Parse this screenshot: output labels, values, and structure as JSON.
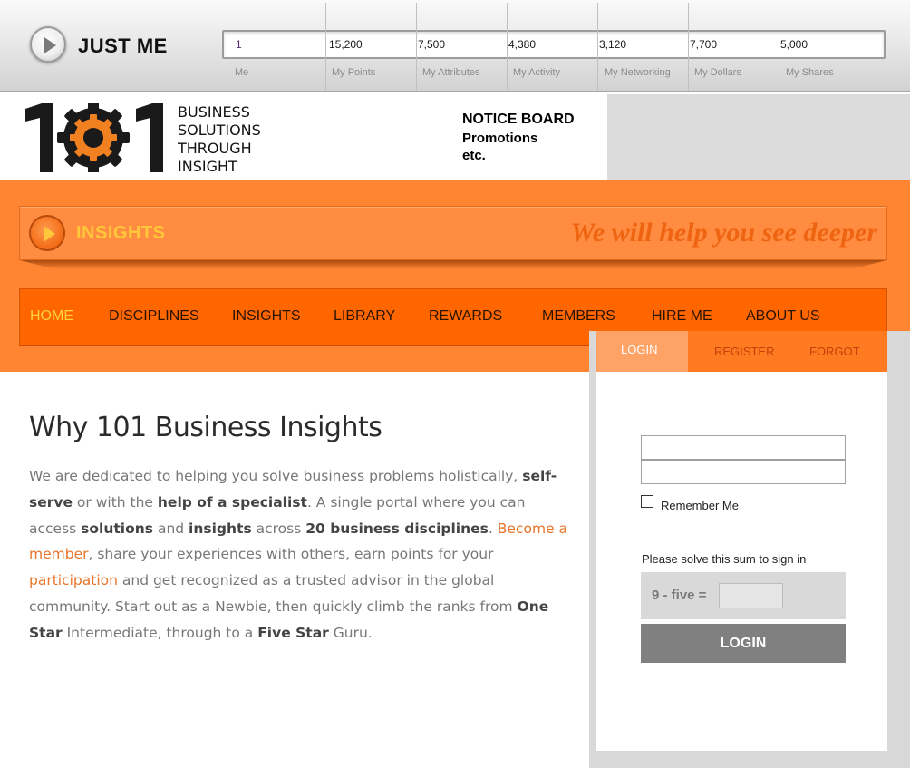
{
  "header": {
    "title": "JUST ME",
    "stats": [
      {
        "value": "1",
        "label": "Me"
      },
      {
        "value": "15,200",
        "label": "My Points"
      },
      {
        "value": "7,500",
        "label": "My Attributes"
      },
      {
        "value": "4,380",
        "label": "My Activity"
      },
      {
        "value": "3,120",
        "label": "My Networking"
      },
      {
        "value": "7,700",
        "label": "My Dollars"
      },
      {
        "value": "5,000",
        "label": "My Shares"
      }
    ]
  },
  "branding": {
    "tagline": [
      "BUSINESS",
      "SOLUTIONS",
      "THROUGH",
      "INSIGHT"
    ],
    "logo_colors": {
      "digits": "#1a1a1a",
      "gear": "#f08020"
    }
  },
  "notice_board": {
    "title": "NOTICE BOARD",
    "lines": [
      "Promotions",
      "etc."
    ]
  },
  "insights_banner": {
    "title": "INSIGHTS",
    "slogan": "We will help you see deeper"
  },
  "nav": {
    "items": [
      {
        "label": "HOME",
        "active": true
      },
      {
        "label": "DISCIPLINES"
      },
      {
        "label": "INSIGHTS"
      },
      {
        "label": "LIBRARY"
      },
      {
        "label": "REWARDS"
      },
      {
        "label": "MEMBERS"
      },
      {
        "label": "HIRE ME"
      },
      {
        "label": "ABOUT US"
      }
    ]
  },
  "login": {
    "tabs": [
      "LOGIN",
      "REGISTER",
      "FORGOT"
    ],
    "username_value": "",
    "password_value": "",
    "remember_label": "Remember Me",
    "solve_label": "Please solve this sum to sign in",
    "captcha_question": "9 - five =",
    "captcha_value": "",
    "button_label": "LOGIN"
  },
  "main": {
    "heading": "Why 101 Business Insights",
    "p": {
      "t1": "We are dedicated to helping you solve business problems holistically, ",
      "b1": "self-serve",
      "t2": " or with the ",
      "b2": "help of a specialist",
      "t3": ". A single portal where you can access ",
      "b3": "solutions",
      "t4": " and ",
      "b4": "insights",
      "t5": " across ",
      "b5": "20 business disciplines",
      "t6": ". ",
      "l1": "Become a member",
      "t7": ", share your experiences with others, earn points for your ",
      "l2": "participation",
      "t8": " and get recognized as a trusted advisor in the global community. Start out as a Newbie, then quickly climb the ranks from ",
      "b6": "One Star",
      "t9": " Intermediate, through to a ",
      "b7": "Five Star",
      "t10": " Guru."
    }
  },
  "icons": {
    "justme": "play-circle-icon",
    "insights": "play-circle-icon",
    "logo_gear": "gear-icon"
  }
}
